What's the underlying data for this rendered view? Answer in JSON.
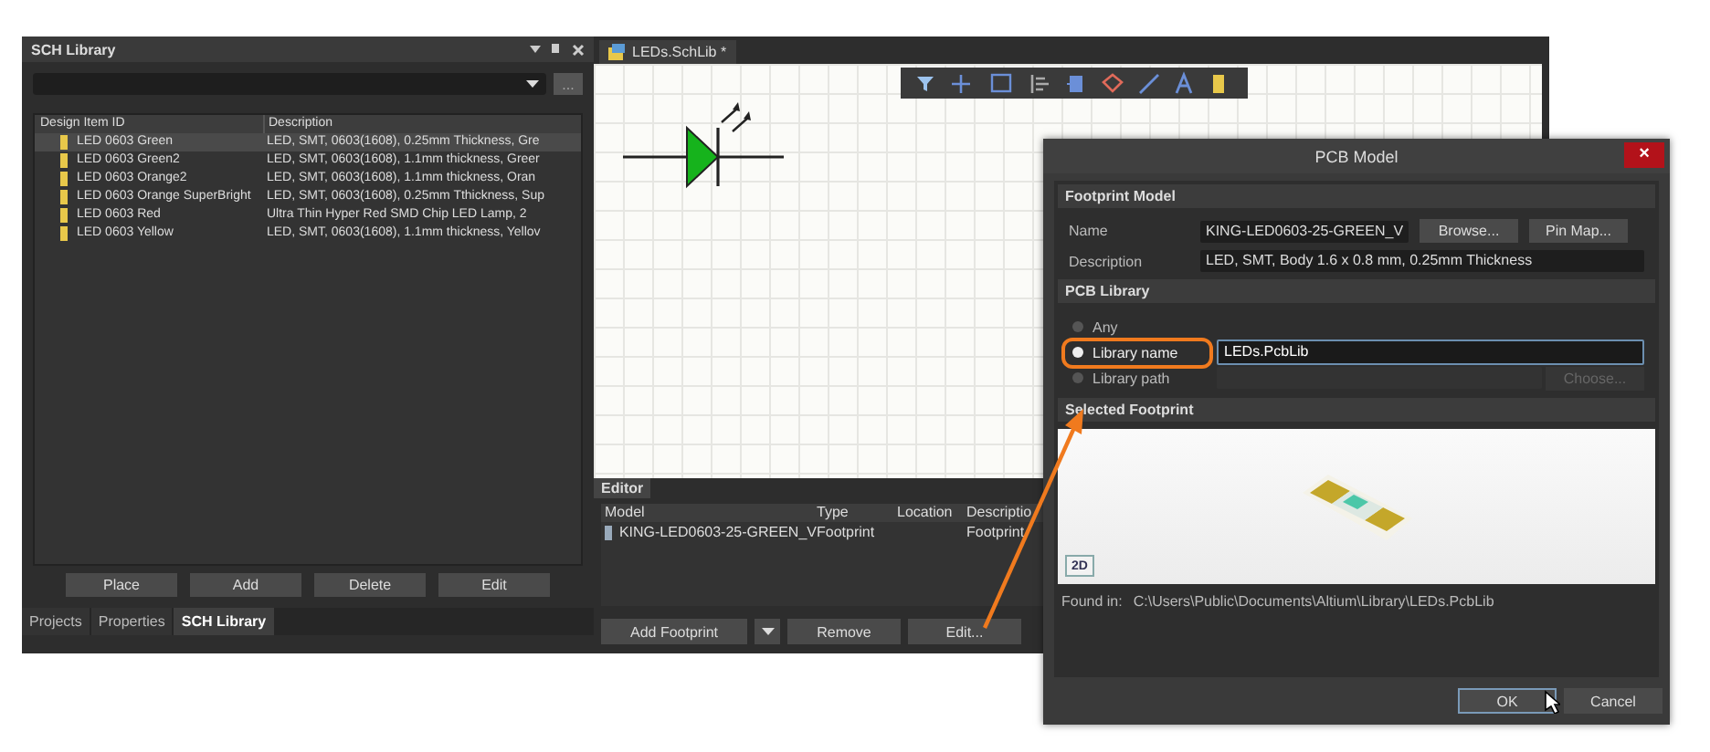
{
  "library_panel": {
    "title": "SCH Library",
    "browse_button": "...",
    "columns": [
      "Design Item ID",
      "Description"
    ],
    "rows": [
      {
        "id": "LED 0603 Green",
        "description": "LED, SMT, 0603(1608), 0.25mm Thickness, Gre",
        "selected": true
      },
      {
        "id": "LED 0603 Green2",
        "description": "LED, SMT, 0603(1608), 1.1mm thickness, Greer",
        "selected": false
      },
      {
        "id": "LED 0603 Orange2",
        "description": "LED, SMT, 0603(1608), 1.1mm thickness, Oran",
        "selected": false
      },
      {
        "id": "LED 0603 Orange SuperBright",
        "description": "LED, SMT, 0603(1608), 0.25mm Tthickness, Sup",
        "selected": false
      },
      {
        "id": "LED 0603 Red",
        "description": "Ultra Thin Hyper Red SMD Chip LED Lamp, 2",
        "selected": false
      },
      {
        "id": "LED 0603 Yellow",
        "description": "LED, SMT, 0603(1608), 1.1mm thickness, Yellov",
        "selected": false
      }
    ],
    "buttons": [
      "Place",
      "Add",
      "Delete",
      "Edit"
    ],
    "tabs": [
      {
        "label": "Projects",
        "selected": false
      },
      {
        "label": "Properties",
        "selected": false
      },
      {
        "label": "SCH Library",
        "selected": true
      }
    ]
  },
  "document": {
    "tab": "LEDs.SchLib *"
  },
  "editor": {
    "tab": "Editor",
    "columns": [
      "Model",
      "Type",
      "Location",
      "Descriptio"
    ],
    "rows": [
      {
        "model": "KING-LED0603-25-GREEN_V",
        "type": "Footprint",
        "location": "",
        "description": "Footprint"
      }
    ],
    "buttons": [
      "Add Footprint",
      "Remove",
      "Edit..."
    ]
  },
  "dialog": {
    "title": "PCB Model",
    "close": "×",
    "footprint_section": "Footprint Model",
    "name_label": "Name",
    "name_value": "KING-LED0603-25-GREEN_V",
    "browse_button": "Browse...",
    "pin_map_button": "Pin Map...",
    "description_label": "Description",
    "description_value": "LED, SMT, Body 1.6 x 0.8 mm, 0.25mm Thickness",
    "library_section": "PCB Library",
    "options": [
      {
        "label": "Any",
        "selected": false
      },
      {
        "label": "Library name",
        "selected": true,
        "value": "LEDs.PcbLib"
      },
      {
        "label": "Library path",
        "selected": false
      }
    ],
    "choose_button": {
      "label": "Choose...",
      "disabled": true
    },
    "selected_section": "Selected Footprint",
    "view_button": "2D",
    "found_label": "Found in:",
    "found_path": "C:\\Users\\Public\\Documents\\Altium\\Library\\LEDs.PcbLib",
    "buttons": [
      "OK",
      "Cancel"
    ]
  }
}
